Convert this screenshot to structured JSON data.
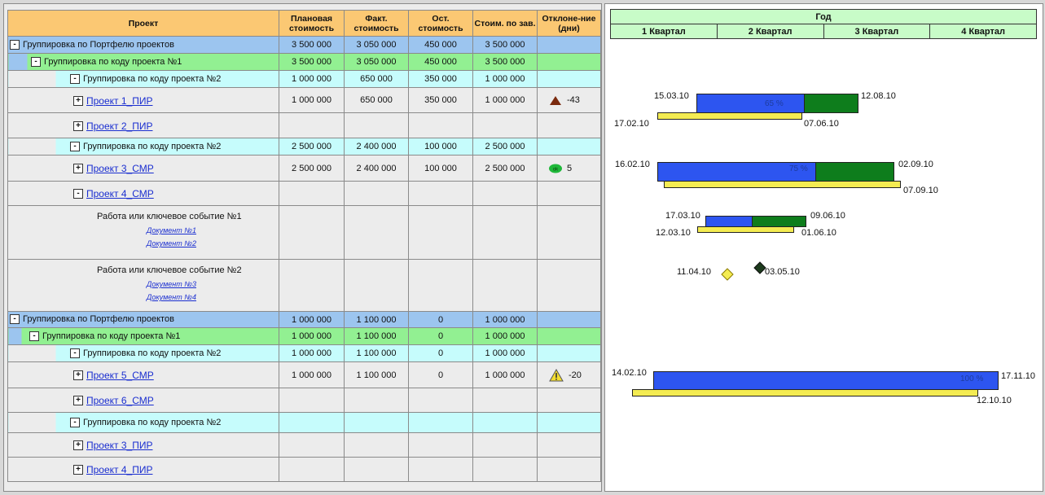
{
  "headers": {
    "project": "Проект",
    "plan": "Плановая стоимость",
    "fact": "Факт. стоимость",
    "rest": "Ост. стоимость",
    "completion": "Стоим. по зав.",
    "deviation": "Отклоне-ние (дни)"
  },
  "rows": {
    "r0": {
      "label": "Группировка по Портфелю проектов",
      "plan": "3 500 000",
      "fact": "3 050 000",
      "rest": "450 000",
      "completion": "3 500 000"
    },
    "r1": {
      "label": "Группировка по коду проекта №1",
      "plan": "3 500 000",
      "fact": "3 050 000",
      "rest": "450 000",
      "completion": "3 500 000"
    },
    "r2": {
      "label": "Группировка по коду проекта №2",
      "plan": "1 000 000",
      "fact": "650 000",
      "rest": "350 000",
      "completion": "1 000 000"
    },
    "r3": {
      "label": "Проект 1_ПИР",
      "plan": "1 000 000",
      "fact": "650 000",
      "rest": "350 000",
      "completion": "1 000 000",
      "deviation": "-43"
    },
    "r4": {
      "label": "Проект 2_ПИР"
    },
    "r5": {
      "label": "Группировка по коду проекта №2",
      "plan": "2 500 000",
      "fact": "2 400 000",
      "rest": "100 000",
      "completion": "2 500 000"
    },
    "r6": {
      "label": "Проект 3_СМР",
      "plan": "2 500 000",
      "fact": "2 400 000",
      "rest": "100 000",
      "completion": "2 500 000",
      "deviation": "5",
      "badge": "ok"
    },
    "r7": {
      "label": "Проект 4_СМР"
    },
    "r8": {
      "label": "Работа или ключевое событие №1",
      "doc1": "Документ №1",
      "doc2": "Документ №2"
    },
    "r9": {
      "label": "Работа или ключевое событие №2",
      "doc1": "Документ №3",
      "doc2": "Документ №4"
    },
    "r10": {
      "label": "Группировка по Портфелю проектов",
      "plan": "1 000 000",
      "fact": "1 100 000",
      "rest": "0",
      "completion": "1 000 000"
    },
    "r11": {
      "label": "Группировка по коду проекта №1",
      "plan": "1 000 000",
      "fact": "1 100 000",
      "rest": "0",
      "completion": "1 000 000"
    },
    "r12": {
      "label": "Группировка по коду проекта №2",
      "plan": "1 000 000",
      "fact": "1 100 000",
      "rest": "0",
      "completion": "1 000 000"
    },
    "r13": {
      "label": "Проект 5_СМР",
      "plan": "1 000 000",
      "fact": "1 100 000",
      "rest": "0",
      "completion": "1 000 000",
      "deviation": "-20"
    },
    "r14": {
      "label": "Проект 6_СМР"
    },
    "r15": {
      "label": "Группировка по коду проекта №2"
    },
    "r16": {
      "label": "Проект 3_ПИР"
    },
    "r17": {
      "label": "Проект 4_ПИР"
    }
  },
  "toggles": {
    "minus": "-",
    "plus": "+"
  },
  "timeline": {
    "year": "Год",
    "q1": "1 Квартал",
    "q2": "2 Квартал",
    "q3": "3 Квартал",
    "q4": "4 Квартал",
    "p1": {
      "start": "15.03.10",
      "end": "12.08.10",
      "plan_start": "17.02.10",
      "plan_end": "07.06.10",
      "pct": "65 %"
    },
    "p3": {
      "start": "16.02.10",
      "end": "02.09.10",
      "plan_end": "07.09.10",
      "pct": "75 %"
    },
    "w1": {
      "start": "17.03.10",
      "end": "09.06.10",
      "plan_start": "12.03.10",
      "plan_end": "01.06.10"
    },
    "ms": {
      "plan": "11.04.10",
      "fact": "03.05.10"
    },
    "p5": {
      "start": "14.02.10",
      "end": "17.11.10",
      "plan_end": "12.10.10",
      "pct": "100 %"
    }
  },
  "colors": {
    "header": "#fbc873",
    "portfolio": "#9cc5ef",
    "code1": "#92f092",
    "code2": "#c6fcfc",
    "fact_bar": "#2d55f0",
    "rest_bar": "#0e7d1c",
    "plan_bar": "#f4ec52",
    "warning": "#f3dd2f",
    "late": "#7a2a0e"
  }
}
